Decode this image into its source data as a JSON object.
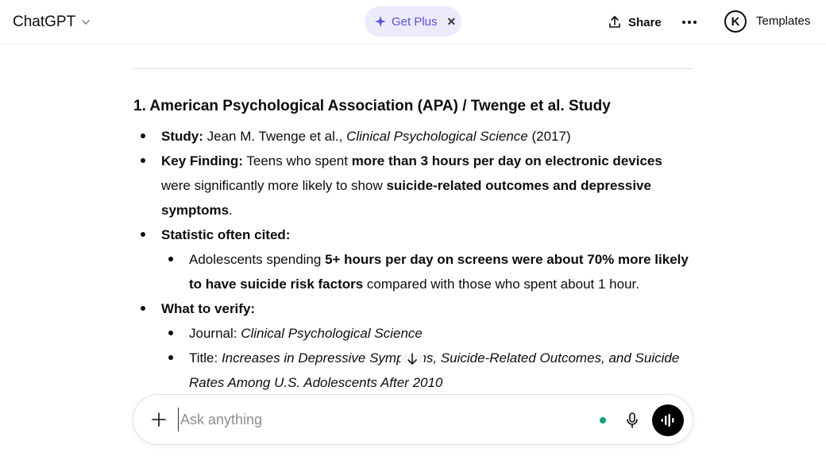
{
  "header": {
    "model_name": "ChatGPT",
    "get_plus_label": "Get Plus",
    "share_label": "Share",
    "avatar_initial": "K",
    "templates_label": "Templates"
  },
  "content": {
    "section_title": "1. American Psychological Association (APA) / Twenge et al. Study",
    "study_label": "Study:",
    "study_text": " Jean M. Twenge et al., ",
    "study_journal": "Clinical Psychological Science",
    "study_year": " (2017)",
    "finding_label": "Key Finding:",
    "finding_text1": " Teens who spent ",
    "finding_bold1": "more than 3 hours per day on electronic devices",
    "finding_text2": " were significantly more likely to show ",
    "finding_bold2": "suicide-related outcomes and depressive symptoms",
    "finding_text3": ".",
    "statistic_label": "Statistic often cited:",
    "statistic_text1": "Adolescents spending ",
    "statistic_bold": "5+ hours per day on screens were about 70% more likely to have suicide risk factors",
    "statistic_text2": " compared with those who spent about 1 hour.",
    "verify_label": "What to verify:",
    "journal_label": "Journal: ",
    "journal_name": "Clinical Psychological Science",
    "title_label": "Title: ",
    "title_name": "Increases in Depressive Symptoms, Suicide-Related Outcomes, and Suicide Rates Among U.S. Adolescents After 2010"
  },
  "composer": {
    "placeholder": "Ask anything",
    "value": ""
  },
  "icons": {
    "chevron": "chevron-down-icon",
    "sparkle": "sparkle-icon",
    "close": "close-icon",
    "share": "share-icon",
    "more": "more-icon",
    "add": "plus-icon",
    "mic": "microphone-icon",
    "voice": "voice-mode-icon",
    "scroll": "arrow-down-icon"
  },
  "colors": {
    "accent": "#5b4fd6",
    "plus_bg": "#ecebfc",
    "status": "#10a37f"
  }
}
